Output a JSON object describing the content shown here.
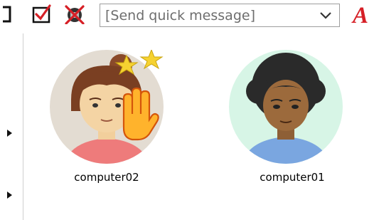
{
  "toolbar": {
    "icons": [
      "partial-icon",
      "check-box-icon",
      "no-screen-icon"
    ],
    "quick_message": {
      "placeholder": "[Send quick message]",
      "value": ""
    },
    "font_button_label": "A",
    "accent_color": "#d61f26"
  },
  "participants": [
    {
      "name": "computer02",
      "avatar": "girl-avatar-icon",
      "raised_hand": true,
      "rewards": [
        "star-icon",
        "star-icon"
      ]
    },
    {
      "name": "computer01",
      "avatar": "boy-avatar-icon",
      "raised_hand": false,
      "rewards": []
    }
  ]
}
